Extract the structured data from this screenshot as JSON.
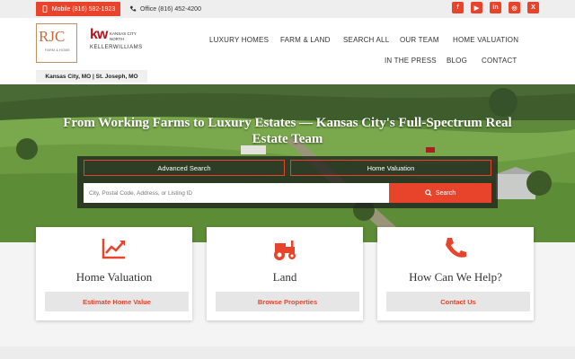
{
  "topbar": {
    "mobile_label": "Mobile (816) 582-1923",
    "office_label": "Office (816) 452-4200",
    "social_icons": [
      "facebook-icon",
      "youtube-icon",
      "linkedin-icon",
      "instagram-icon",
      "x-icon"
    ]
  },
  "logo": {
    "rjc": "RJC",
    "rjc_sub": "FARM & HOME",
    "kw": "kw",
    "kw_city": "KANSAS CITY NORTH",
    "kw_name": "KELLERWILLIAMS",
    "location": "Kansas City, MO | St. Joseph, MO"
  },
  "nav": {
    "items": [
      "LUXURY HOMES",
      "FARM & LAND",
      "SEARCH ALL",
      "OUR TEAM",
      "HOME VALUATION",
      "IN THE PRESS",
      "BLOG",
      "CONTACT"
    ]
  },
  "hero": {
    "title": "From Working Farms to Luxury Estates — Kansas City's Full-Spectrum Real Estate Team",
    "tab_advanced": "Advanced Search",
    "tab_valuation": "Home Valuation",
    "search_placeholder": "City, Postal Code, Address, or Listing ID",
    "search_button": "Search"
  },
  "cards": [
    {
      "title": "Home Valuation",
      "button": "Estimate Home Value",
      "icon": "chart-up-icon"
    },
    {
      "title": "Land",
      "button": "Browse Properties",
      "icon": "tractor-icon"
    },
    {
      "title": "How Can We Help?",
      "button": "Contact Us",
      "icon": "phone-icon"
    }
  ],
  "colors": {
    "accent": "#e8432b",
    "brand_kw": "#b4121b",
    "rjc": "#c8693a"
  }
}
